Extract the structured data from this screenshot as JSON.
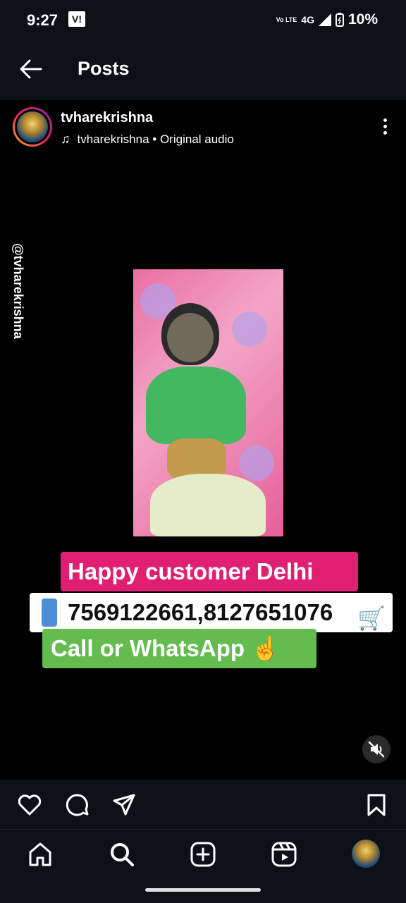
{
  "status": {
    "time": "9:27",
    "carrier_badge": "V!",
    "network_label": "4G",
    "volte": "Vo LTE",
    "battery": "10%"
  },
  "header": {
    "title": "Posts",
    "back_icon": "arrow-left-icon"
  },
  "post": {
    "username": "tvharekrishna",
    "audio": "tvharekrishna • Original audio",
    "more_icon": "more-vertical-icon"
  },
  "video": {
    "watermark": "@tvharekrishna",
    "tag_line_1": "Happy customer Delhi",
    "tag_line_2": "7569122661,8127651076",
    "tag_line_3": "Call or WhatsApp ☝",
    "mute_icon": "volume-muted-icon",
    "colors": {
      "pink": "#e01f73",
      "green": "#64bc4f",
      "white": "#ffffff"
    }
  },
  "actions": {
    "icons": [
      "heart-icon",
      "comment-icon",
      "share-icon",
      "bookmark-icon"
    ]
  },
  "nav": {
    "icons": [
      "home-icon",
      "search-icon",
      "create-icon",
      "reels-icon",
      "profile-avatar"
    ]
  }
}
